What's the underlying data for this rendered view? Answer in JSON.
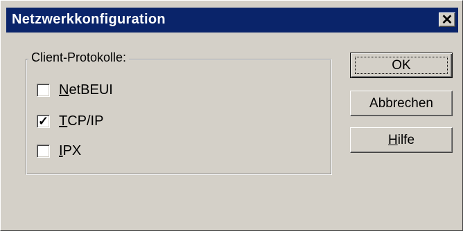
{
  "window": {
    "title": "Netzwerkkonfiguration",
    "close_glyph": "✕"
  },
  "group": {
    "label": "Client-Protokolle:"
  },
  "protocols": [
    {
      "label": "NetBEUI",
      "mnemonic_index": 0,
      "checked": false
    },
    {
      "label": "TCP/IP",
      "mnemonic_index": 0,
      "checked": true
    },
    {
      "label": "IPX",
      "mnemonic_index": 0,
      "checked": false
    }
  ],
  "buttons": {
    "ok": "OK",
    "cancel": "Abbrechen",
    "help": "Hilfe"
  },
  "colors": {
    "titlebar": "#0a246a",
    "face": "#d4d0c8"
  }
}
